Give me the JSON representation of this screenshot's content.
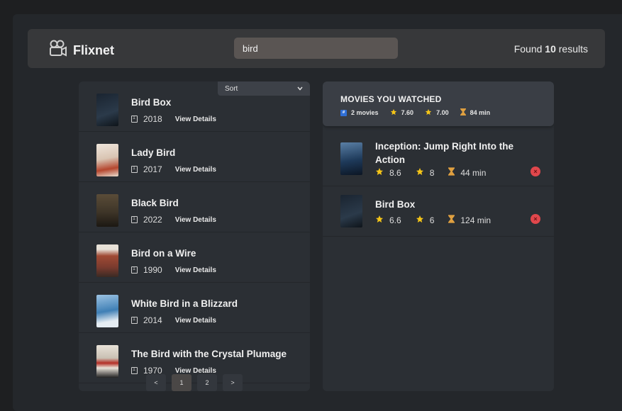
{
  "app": {
    "name": "Flixnet"
  },
  "search": {
    "value": "bird"
  },
  "results": {
    "prefix": "Found",
    "count": "10",
    "suffix": "results"
  },
  "sort": {
    "label": "Sort"
  },
  "movies": [
    {
      "title": "Bird Box",
      "year": "2018",
      "details_label": "View Details",
      "poster_color": "#2b3a4a"
    },
    {
      "title": "Lady Bird",
      "year": "2017",
      "details_label": "View Details",
      "poster_color": "#d9c4b2"
    },
    {
      "title": "Black Bird",
      "year": "2022",
      "details_label": "View Details",
      "poster_color": "#3e3528"
    },
    {
      "title": "Bird on a Wire",
      "year": "1990",
      "details_label": "View Details",
      "poster_color": "#7a3b2e"
    },
    {
      "title": "White Bird in a Blizzard",
      "year": "2014",
      "details_label": "View Details",
      "poster_color": "#3f7fb5"
    },
    {
      "title": "The Bird with the Crystal Plumage",
      "year": "1970",
      "details_label": "View Details",
      "poster_color": "#c9c0b3"
    }
  ],
  "pagination": {
    "prev": "<",
    "pages": [
      "1",
      "2"
    ],
    "next": ">",
    "active": "1"
  },
  "watched": {
    "title": "MOVIES YOU WATCHED",
    "stats": {
      "count": "2 movies",
      "imdb_avg": "7.60",
      "user_avg": "7.00",
      "runtime_avg": "84 min"
    },
    "items": [
      {
        "title": "Inception: Jump Right Into the Action",
        "imdb": "8.6",
        "user": "8",
        "runtime": "44 min",
        "remove": "×",
        "poster_color": "#1e3a5a"
      },
      {
        "title": "Bird Box",
        "imdb": "6.6",
        "user": "6",
        "runtime": "124 min",
        "remove": "×",
        "poster_color": "#2b3a4a"
      }
    ]
  },
  "colors": {
    "accent_star": "#f5c518",
    "remove": "#e0474c",
    "background": "#24272b"
  }
}
